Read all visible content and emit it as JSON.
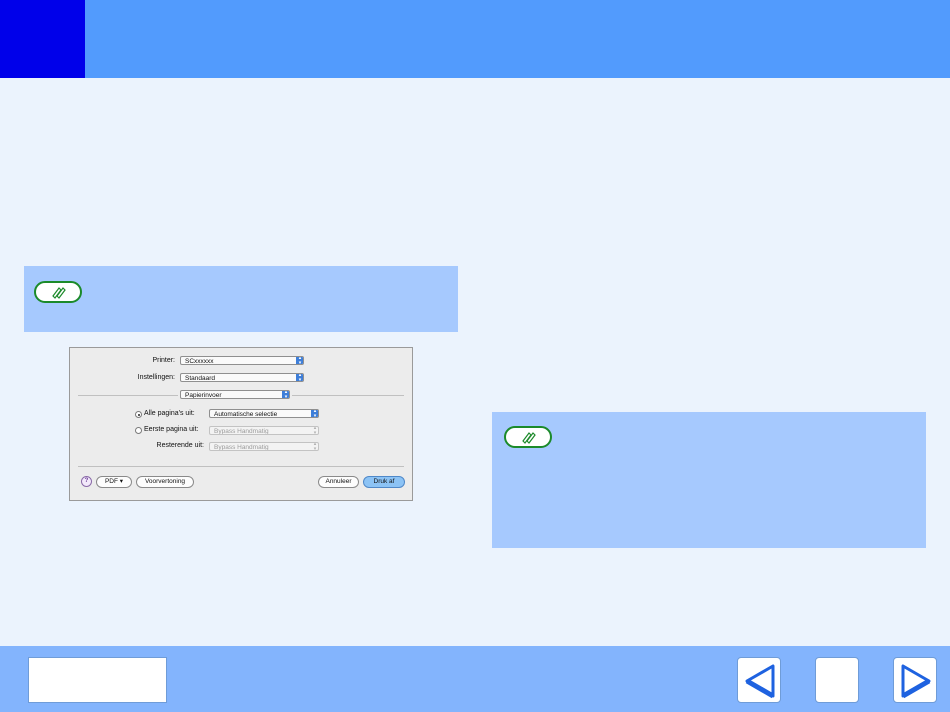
{
  "dialog": {
    "printer_label": "Printer:",
    "printer_value": "SCxxxxxx",
    "settings_label": "Instellingen:",
    "settings_value": "Standaard",
    "panel_value": "Papierinvoer",
    "all_pages_label": "Alle pagina's uit:",
    "all_pages_value": "Automatische selectie",
    "first_page_label": "Eerste pagina uit:",
    "first_page_value": "Bypass Handmatig",
    "remaining_label": "Resterende uit:",
    "remaining_value": "Bypass Handmatig",
    "help_label": "?",
    "pdf_label": "PDF ▾",
    "preview_label": "Voorvertoning",
    "cancel_label": "Annuleer",
    "print_label": "Druk af"
  },
  "icons": {
    "note_left": "note-pencil-icon",
    "note_right": "note-pencil-icon",
    "prev": "arrow-left-icon",
    "next": "arrow-right-icon"
  },
  "colors": {
    "header": "#529bfd",
    "header_square": "#0000ea",
    "note_bg": "#a6c9fe",
    "footer": "#83b4fd",
    "nav_arrow": "#1e62e0"
  }
}
